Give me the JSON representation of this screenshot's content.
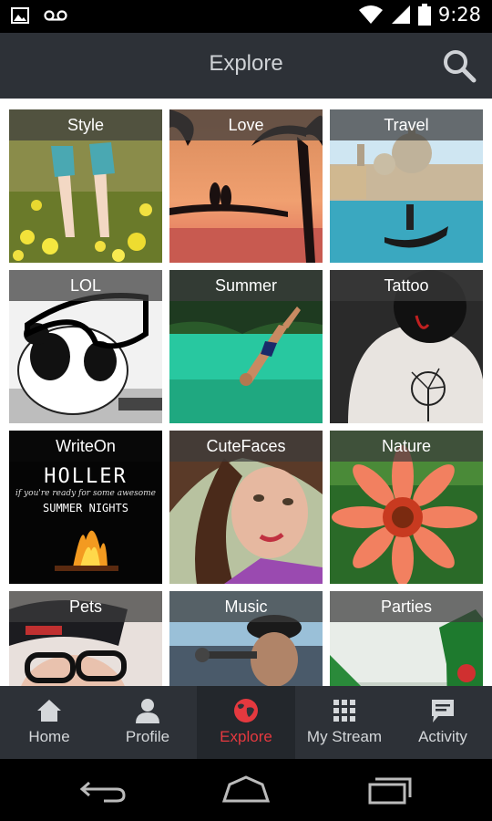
{
  "status_bar": {
    "time": "9:28",
    "left_icons": [
      "image-icon",
      "voicemail-icon"
    ],
    "right_icons": [
      "wifi-icon",
      "signal-icon",
      "battery-icon"
    ]
  },
  "header": {
    "title": "Explore",
    "search_icon": "search-icon"
  },
  "categories": [
    {
      "label": "Style"
    },
    {
      "label": "Love"
    },
    {
      "label": "Travel"
    },
    {
      "label": "LOL"
    },
    {
      "label": "Summer"
    },
    {
      "label": "Tattoo"
    },
    {
      "label": "WriteOn"
    },
    {
      "label": "CuteFaces"
    },
    {
      "label": "Nature"
    },
    {
      "label": "Pets"
    },
    {
      "label": "Music"
    },
    {
      "label": "Parties"
    }
  ],
  "writeon_art": {
    "line1": "HOLLER",
    "line2": "if you're ready for some awesome",
    "line3": "SUMMER NIGHTS"
  },
  "tabs": [
    {
      "label": "Home",
      "icon": "home-icon"
    },
    {
      "label": "Profile",
      "icon": "person-icon"
    },
    {
      "label": "Explore",
      "icon": "globe-icon",
      "active": true
    },
    {
      "label": "My Stream",
      "icon": "grid-icon"
    },
    {
      "label": "Activity",
      "icon": "chat-icon"
    }
  ],
  "colors": {
    "header_bg": "#2d3137",
    "accent": "#e5393f",
    "tab_text": "#d4d7da"
  },
  "system_nav": [
    "back-icon",
    "home-nav-icon",
    "recents-icon"
  ]
}
